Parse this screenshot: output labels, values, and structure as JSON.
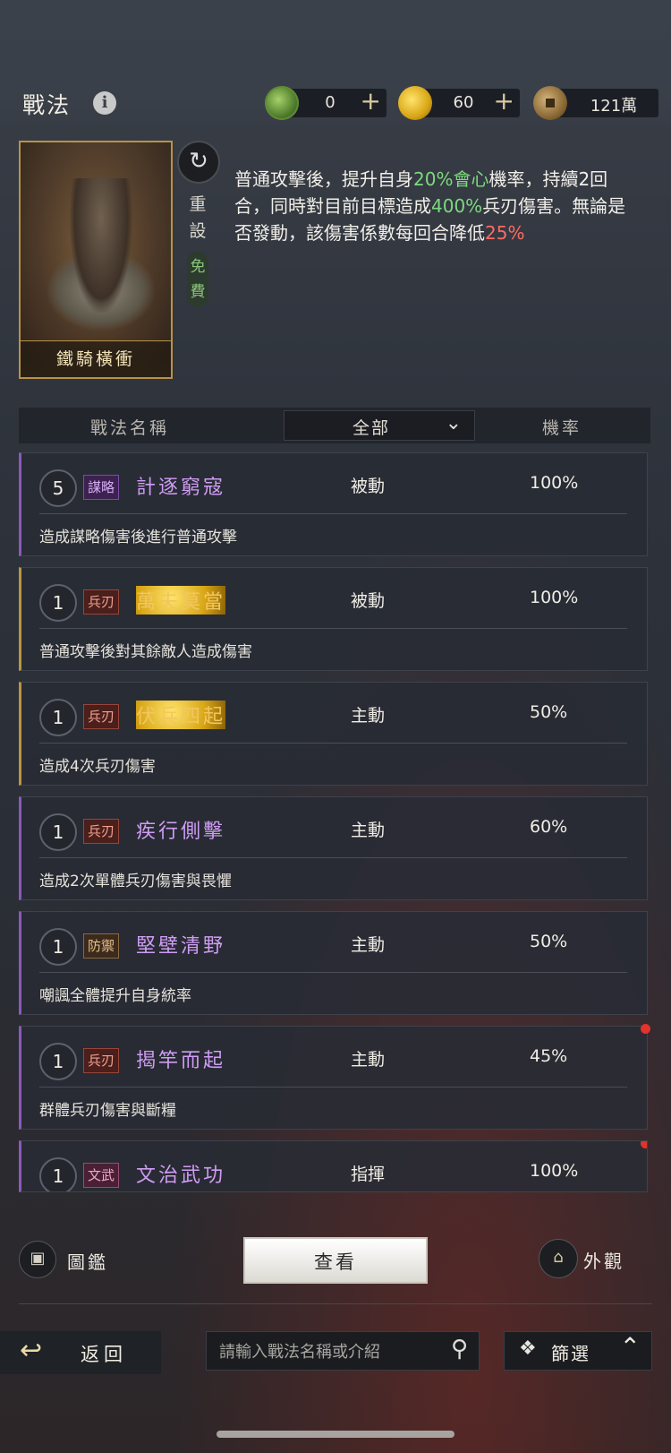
{
  "header": {
    "title": "戰法",
    "info_icon": "i",
    "resources": [
      {
        "icon": "jade-coin-icon",
        "value": "0",
        "plus": "+"
      },
      {
        "icon": "gold-coin-icon",
        "value": "60",
        "plus": "+"
      },
      {
        "icon": "copper-coin-icon",
        "value": "121萬"
      }
    ]
  },
  "featured": {
    "card_name": "鐵騎橫衝",
    "reset_icon": "↻",
    "reset_label": "重設",
    "free_label": "免費",
    "desc": [
      {
        "t": "普通攻擊後，提升自身",
        "c": ""
      },
      {
        "t": "20%會心",
        "c": "green"
      },
      {
        "t": "機率，持續2回合，同時對目前目標造成",
        "c": ""
      },
      {
        "t": "400%",
        "c": "green"
      },
      {
        "t": "兵刃傷害。無論是否發動，該傷害係數每回合降低",
        "c": ""
      },
      {
        "t": "25%",
        "c": "red"
      }
    ]
  },
  "columns": {
    "name": "戰法名稱",
    "filter": "全部",
    "rate": "機率"
  },
  "skills": [
    {
      "level": "5",
      "tag": "謀略",
      "tag_style": "purple",
      "name": "計逐窮寇",
      "name_style": "purple",
      "border": "purple",
      "type": "被動",
      "rate": "100%",
      "desc": "造成謀略傷害後進行普通攻擊",
      "dot": false
    },
    {
      "level": "1",
      "tag": "兵刃",
      "tag_style": "redtag",
      "name": "萬夫莫當",
      "name_style": "gold",
      "border": "gold",
      "type": "被動",
      "rate": "100%",
      "desc": "普通攻擊後對其餘敵人造成傷害",
      "dot": false
    },
    {
      "level": "1",
      "tag": "兵刃",
      "tag_style": "redtag",
      "name": "伏兵四起",
      "name_style": "gold",
      "border": "gold",
      "type": "主動",
      "rate": "50%",
      "desc": "造成4次兵刃傷害",
      "dot": false
    },
    {
      "level": "1",
      "tag": "兵刃",
      "tag_style": "redtag",
      "name": "疾行側擊",
      "name_style": "purple",
      "border": "purple",
      "type": "主動",
      "rate": "60%",
      "desc": "造成2次單體兵刃傷害與畏懼",
      "dot": false
    },
    {
      "level": "1",
      "tag": "防禦",
      "tag_style": "brown",
      "name": "堅壁清野",
      "name_style": "purple",
      "border": "purple",
      "type": "主動",
      "rate": "50%",
      "desc": "嘲諷全體提升自身統率",
      "dot": false
    },
    {
      "level": "1",
      "tag": "兵刃",
      "tag_style": "redtag",
      "name": "揭竿而起",
      "name_style": "purple",
      "border": "purple",
      "type": "主動",
      "rate": "45%",
      "desc": "群體兵刃傷害與斷糧",
      "dot": true
    },
    {
      "level": "1",
      "tag": "文武",
      "tag_style": "mixed",
      "name": "文治武功",
      "name_style": "purple",
      "border": "purple",
      "type": "指揮",
      "rate": "100%",
      "desc": "",
      "dot": true
    }
  ],
  "bottom": {
    "catalog_label": "圖鑑",
    "view_label": "查看",
    "appearance_label": "外觀",
    "back_label": "返回",
    "search_placeholder": "請輸入戰法名稱或介紹",
    "filter_label": "篩選"
  }
}
